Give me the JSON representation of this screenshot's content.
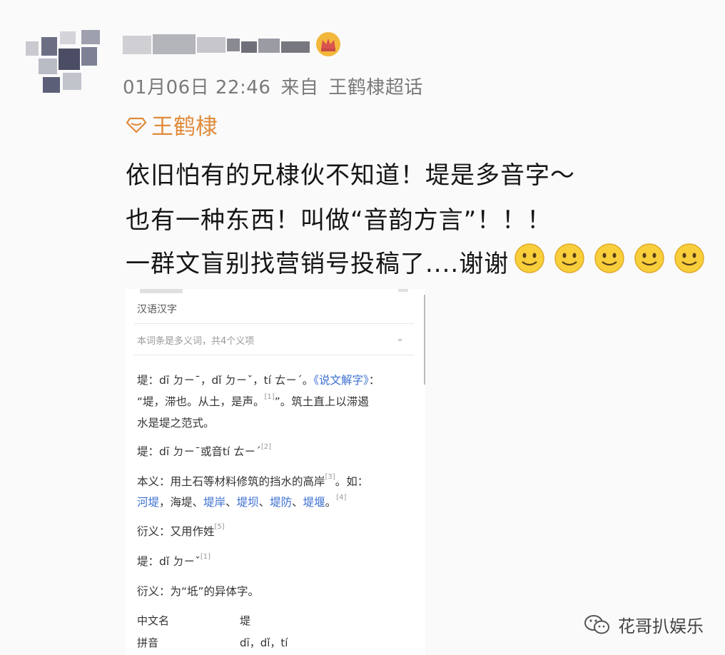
{
  "post": {
    "meta_time": "01月06日 22:46",
    "meta_from": "来自",
    "meta_topic": "王鹤棣超话",
    "topic_tag": "王鹤棣",
    "lines": [
      "依旧怕有的兄棣伙不知道！堤是多音字～",
      "也有一种东西！叫做“音韵方言”！！！",
      "一群文盲别找营销号投稿了....谢谢"
    ],
    "emoji_name": "smile-emoji"
  },
  "screenshot": {
    "header": "汉语汉字",
    "subheader": "本词条是多义词，共4个义项",
    "chevron": "⌄",
    "p1_a": "堤：dī ㄉㄧˉ，dǐ ㄉㄧˇ，tí ㄊㄧˊ。",
    "p1_link": "《说文解字》",
    "p1_b": "：",
    "p1_c": "“堤，滞也。从土，是声。",
    "p1_sup": "[1]",
    "p1_d": "”。筑土直上以滞遏",
    "p1_e": "水是堤之范式。",
    "p2": "堤：dī ㄉㄧˉ或音tí ㄊㄧˊ",
    "p2_sup": "[2]",
    "p3_a": "本义：用土石等材料修筑的挡水的高岸",
    "p3_sup": "[3]",
    "p3_b": "。如：",
    "p3_links": [
      "河堤",
      "海堤",
      "堤岸",
      "堤坝",
      "堤防",
      "堤堰"
    ],
    "p3_plain": [
      "，",
      "、",
      "、",
      "、",
      "、",
      "。"
    ],
    "p3_sup2": "[4]",
    "p4": "衍义：又用作姓",
    "p4_sup": "[5]",
    "p5": "堤：dǐ ㄉㄧˇ",
    "p5_sup": "[1]",
    "p6": "衍义：为“坻”的异体字。",
    "table": [
      {
        "k": "中文名",
        "v": "堤"
      },
      {
        "k": "拼音",
        "v": "dī，dǐ，tí"
      }
    ]
  },
  "watermark": "花哥扒娱乐",
  "colors": {
    "topic": "#e08b3a",
    "link": "#3b6fd0",
    "meta": "#7a7a7a"
  }
}
